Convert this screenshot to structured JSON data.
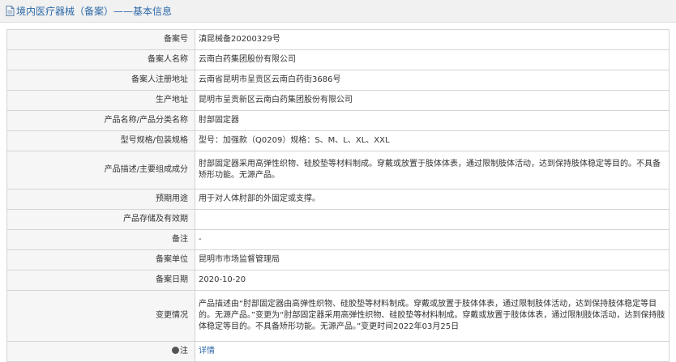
{
  "header": {
    "title": "境内医疗器械（备案）——基本信息"
  },
  "rows": [
    {
      "label": "备案号",
      "value": "滇昆械备20200329号"
    },
    {
      "label": "备案人名称",
      "value": "云南白药集团股份有限公司"
    },
    {
      "label": "备案人注册地址",
      "value": "云南省昆明市呈贡区云南白药街3686号"
    },
    {
      "label": "生产地址",
      "value": "昆明市呈贡新区云南白药集团股份有限公司"
    },
    {
      "label": "产品名称/产品分类名称",
      "value": "肘部固定器"
    },
    {
      "label": "型号规格/包装规格",
      "value": "型号：加强款（Q0209）规格：S、M、L、XL、XXL"
    },
    {
      "label": "产品描述/主要组成成分",
      "value": "肘部固定器采用高弹性织物、硅胶垫等材料制成。穿戴或放置于肢体体表，通过限制肢体活动，达到保持肢体稳定等目的。不具备矫形功能。无源产品。"
    },
    {
      "label": "预期用途",
      "value": "用于对人体肘部的外固定或支撑。"
    },
    {
      "label": "产品存储及有效期",
      "value": ""
    },
    {
      "label": "备注",
      "value": "-"
    },
    {
      "label": "备案单位",
      "value": "昆明市市场监督管理局"
    },
    {
      "label": "备案日期",
      "value": "2020-10-20"
    },
    {
      "label": "变更情况",
      "value": "产品描述由“肘部固定器由高弹性织物、硅胶垫等材料制成。穿戴或放置于肢体体表，通过限制肢体活动，达到保持肢体稳定等目的。无源产品。”变更为“肘部固定器采用高弹性织物、硅胶垫等材料制成。穿戴或放置于肢体体表，通过限制肢体活动，达到保持肢体稳定等目的。不具备矫形功能。无源产品。”变更时间2022年03月25日"
    }
  ],
  "footer": {
    "label": "注",
    "link": "详情"
  }
}
